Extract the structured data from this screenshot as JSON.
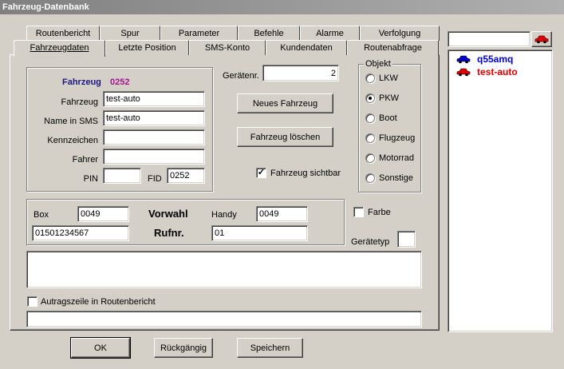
{
  "window": {
    "title": "Fahrzeug-Datenbank"
  },
  "tabs_back": [
    "Routenbericht",
    "Spur",
    "Parameter",
    "Befehle",
    "Alarme",
    "Verfolgung"
  ],
  "tabs_front": [
    "Fahrzeugdaten",
    "Letzte Position",
    "SMS-Konto",
    "Kundendaten",
    "Routenabfrage"
  ],
  "vehicle_box": {
    "header_label": "Fahrzeug",
    "header_id": "0252",
    "fahrzeug_label": "Fahrzeug",
    "fahrzeug_value": "test-auto",
    "sms_name_label": "Name in SMS",
    "sms_name_value": "test-auto",
    "kennzeichen_label": "Kennzeichen",
    "kennzeichen_value": "",
    "fahrer_label": "Fahrer",
    "fahrer_value": "",
    "pin_label": "PIN",
    "pin_value": "",
    "fid_label": "FID",
    "fid_value": "0252"
  },
  "device": {
    "label": "Gerätenr.",
    "value": "2"
  },
  "buttons": {
    "new_vehicle": "Neues Fahrzeug",
    "delete_vehicle": "Fahrzeug löschen",
    "ok": "OK",
    "undo": "Rückgängig",
    "save": "Speichern"
  },
  "visible_checkbox": {
    "label": "Fahrzeug sichtbar",
    "checked": true
  },
  "object_group": {
    "title": "Objekt",
    "options": [
      "LKW",
      "PKW",
      "Boot",
      "Flugzeug",
      "Motorrad",
      "Sonstige"
    ],
    "selected": "PKW"
  },
  "phone_box": {
    "box_label": "Box",
    "box_value": "0049",
    "vorwahl_label": "Vorwahl",
    "handy_label": "Handy",
    "handy_value": "0049",
    "box_number": "01501234567",
    "rufnr_label": "Rufnr.",
    "handy_number": "01"
  },
  "farbe": {
    "label": "Farbe",
    "checked": false
  },
  "geraetetyp": {
    "label": "Gerätetyp",
    "value": ""
  },
  "route_checkbox": {
    "label": "Autragszeile in Routenbericht",
    "checked": false
  },
  "vehicle_list": {
    "search_value": "",
    "items": [
      {
        "name": "q55amq",
        "color": "#0000cc"
      },
      {
        "name": "test-auto",
        "color": "#e00000"
      }
    ]
  }
}
